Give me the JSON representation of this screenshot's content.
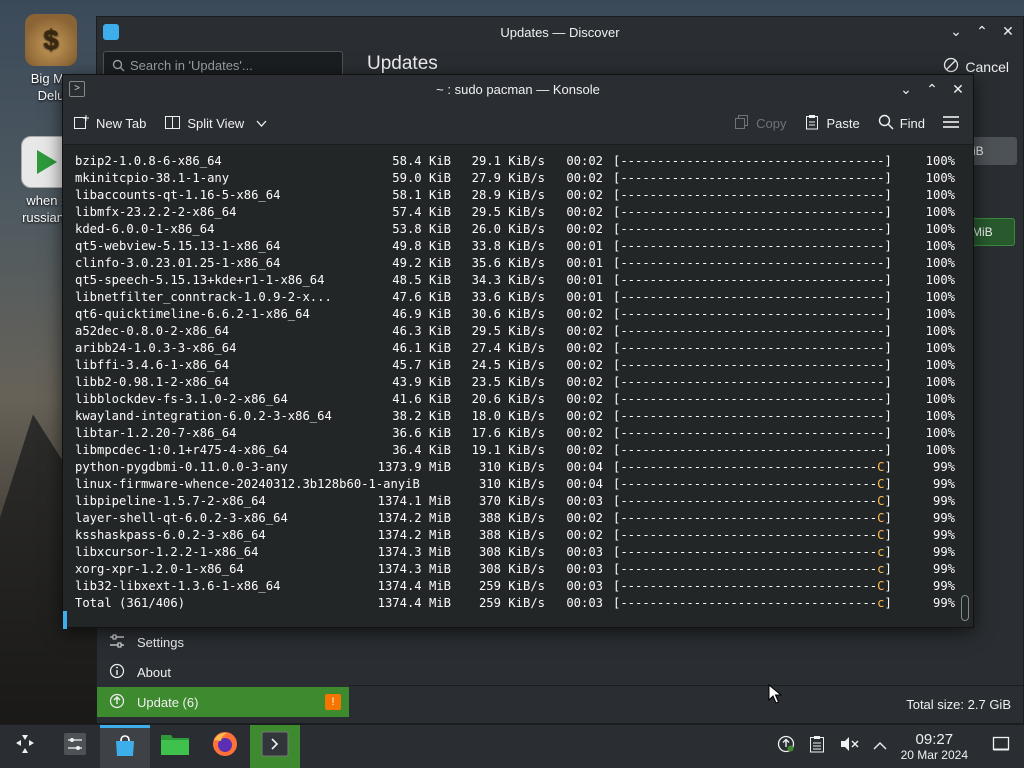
{
  "desktop": {
    "icons": [
      {
        "label_line1": "Big Mo",
        "label_line2": "Delu"
      },
      {
        "label_line1": "when s",
        "label_line2": "russian r"
      }
    ]
  },
  "discover": {
    "title": "Updates — Discover",
    "search_placeholder": "Search in 'Updates'...",
    "heading": "Updates",
    "cancel_label": "Cancel",
    "chip1": "iB",
    "chip2": "MiB",
    "sidebar": {
      "settings": "Settings",
      "about": "About",
      "update": "Update (6)",
      "update_badge": "!"
    },
    "total_size": "Total size: 2.7 GiB"
  },
  "konsole": {
    "title": "~ : sudo pacman — Konsole",
    "toolbar": {
      "new_tab": "New Tab",
      "split_view": "Split View",
      "copy": "Copy",
      "paste": "Paste",
      "find": "Find"
    },
    "lines": [
      {
        "name": "bzip2-1.0.8-6-x86_64",
        "size": "58.4 KiB",
        "rate": "29.1 KiB/s",
        "time": "00:02",
        "bar": "[------------------------------------]",
        "pct": "100%"
      },
      {
        "name": "mkinitcpio-38.1-1-any",
        "size": "59.0 KiB",
        "rate": "27.9 KiB/s",
        "time": "00:02",
        "bar": "[------------------------------------]",
        "pct": "100%"
      },
      {
        "name": "libaccounts-qt-1.16-5-x86_64",
        "size": "58.1 KiB",
        "rate": "28.9 KiB/s",
        "time": "00:02",
        "bar": "[------------------------------------]",
        "pct": "100%"
      },
      {
        "name": "libmfx-23.2.2-2-x86_64",
        "size": "57.4 KiB",
        "rate": "29.5 KiB/s",
        "time": "00:02",
        "bar": "[------------------------------------]",
        "pct": "100%"
      },
      {
        "name": "kded-6.0.0-1-x86_64",
        "size": "53.8 KiB",
        "rate": "26.0 KiB/s",
        "time": "00:02",
        "bar": "[------------------------------------]",
        "pct": "100%"
      },
      {
        "name": "qt5-webview-5.15.13-1-x86_64",
        "size": "49.8 KiB",
        "rate": "33.8 KiB/s",
        "time": "00:01",
        "bar": "[------------------------------------]",
        "pct": "100%"
      },
      {
        "name": "clinfo-3.0.23.01.25-1-x86_64",
        "size": "49.2 KiB",
        "rate": "35.6 KiB/s",
        "time": "00:01",
        "bar": "[------------------------------------]",
        "pct": "100%"
      },
      {
        "name": "qt5-speech-5.15.13+kde+r1-1-x86_64",
        "size": "48.5 KiB",
        "rate": "34.3 KiB/s",
        "time": "00:01",
        "bar": "[------------------------------------]",
        "pct": "100%"
      },
      {
        "name": "libnetfilter_conntrack-1.0.9-2-x...",
        "size": "47.6 KiB",
        "rate": "33.6 KiB/s",
        "time": "00:01",
        "bar": "[------------------------------------]",
        "pct": "100%"
      },
      {
        "name": "qt6-quicktimeline-6.6.2-1-x86_64",
        "size": "46.9 KiB",
        "rate": "30.6 KiB/s",
        "time": "00:02",
        "bar": "[------------------------------------]",
        "pct": "100%"
      },
      {
        "name": "a52dec-0.8.0-2-x86_64",
        "size": "46.3 KiB",
        "rate": "29.5 KiB/s",
        "time": "00:02",
        "bar": "[------------------------------------]",
        "pct": "100%"
      },
      {
        "name": "aribb24-1.0.3-3-x86_64",
        "size": "46.1 KiB",
        "rate": "27.4 KiB/s",
        "time": "00:02",
        "bar": "[------------------------------------]",
        "pct": "100%"
      },
      {
        "name": "libffi-3.4.6-1-x86_64",
        "size": "45.7 KiB",
        "rate": "24.5 KiB/s",
        "time": "00:02",
        "bar": "[------------------------------------]",
        "pct": "100%"
      },
      {
        "name": "libb2-0.98.1-2-x86_64",
        "size": "43.9 KiB",
        "rate": "23.5 KiB/s",
        "time": "00:02",
        "bar": "[------------------------------------]",
        "pct": "100%"
      },
      {
        "name": "libblockdev-fs-3.1.0-2-x86_64",
        "size": "41.6 KiB",
        "rate": "20.6 KiB/s",
        "time": "00:02",
        "bar": "[------------------------------------]",
        "pct": "100%"
      },
      {
        "name": "kwayland-integration-6.0.2-3-x86_64",
        "size": "38.2 KiB",
        "rate": "18.0 KiB/s",
        "time": "00:02",
        "bar": "[------------------------------------]",
        "pct": "100%"
      },
      {
        "name": "libtar-1.2.20-7-x86_64",
        "size": "36.6 KiB",
        "rate": "17.6 KiB/s",
        "time": "00:02",
        "bar": "[------------------------------------]",
        "pct": "100%"
      },
      {
        "name": "libmpcdec-1:0.1+r475-4-x86_64",
        "size": "36.4 KiB",
        "rate": "19.1 KiB/s",
        "time": "00:02",
        "bar": "[------------------------------------]",
        "pct": "100%"
      },
      {
        "name": "python-pygdbmi-0.11.0.0-3-any",
        "size": "1373.9 MiB",
        "rate": "310 KiB/s",
        "time": "00:04",
        "bar": "[-----------------------------------C]",
        "pct": "99%"
      },
      {
        "name": "linux-firmware-whence-20240312.3b128b60-1-anyiB",
        "size": "",
        "rate": "310 KiB/s",
        "time": "00:04",
        "bar": "[-----------------------------------C]",
        "pct": "99%"
      },
      {
        "name": "libpipeline-1.5.7-2-x86_64",
        "size": "1374.1 MiB",
        "rate": "370 KiB/s",
        "time": "00:03",
        "bar": "[-----------------------------------C]",
        "pct": "99%"
      },
      {
        "name": "layer-shell-qt-6.0.2-3-x86_64",
        "size": "1374.2 MiB",
        "rate": "388 KiB/s",
        "time": "00:02",
        "bar": "[-----------------------------------C]",
        "pct": "99%"
      },
      {
        "name": "ksshaskpass-6.0.2-3-x86_64",
        "size": "1374.2 MiB",
        "rate": "388 KiB/s",
        "time": "00:02",
        "bar": "[-----------------------------------C]",
        "pct": "99%"
      },
      {
        "name": "libxcursor-1.2.2-1-x86_64",
        "size": "1374.3 MiB",
        "rate": "308 KiB/s",
        "time": "00:03",
        "bar": "[-----------------------------------c]",
        "pct": "99%"
      },
      {
        "name": "xorg-xpr-1.2.0-1-x86_64",
        "size": "1374.3 MiB",
        "rate": "308 KiB/s",
        "time": "00:03",
        "bar": "[-----------------------------------c]",
        "pct": "99%"
      },
      {
        "name": "lib32-libxext-1.3.6-1-x86_64",
        "size": "1374.4 MiB",
        "rate": "259 KiB/s",
        "time": "00:03",
        "bar": "[-----------------------------------C]",
        "pct": "99%"
      },
      {
        "name": "Total (361/406)",
        "size": "1374.4 MiB",
        "rate": "259 KiB/s",
        "time": "00:03",
        "bar": "[-----------------------------------c]",
        "pct": "99%"
      }
    ]
  },
  "taskbar": {
    "time": "09:27",
    "date": "20 Mar 2024"
  },
  "colors": {
    "accent_blue": "#3daee9",
    "active_green": "#3e8b2f",
    "pacman_yellow": "#fdbc4b",
    "warning_orange": "#f67400"
  }
}
